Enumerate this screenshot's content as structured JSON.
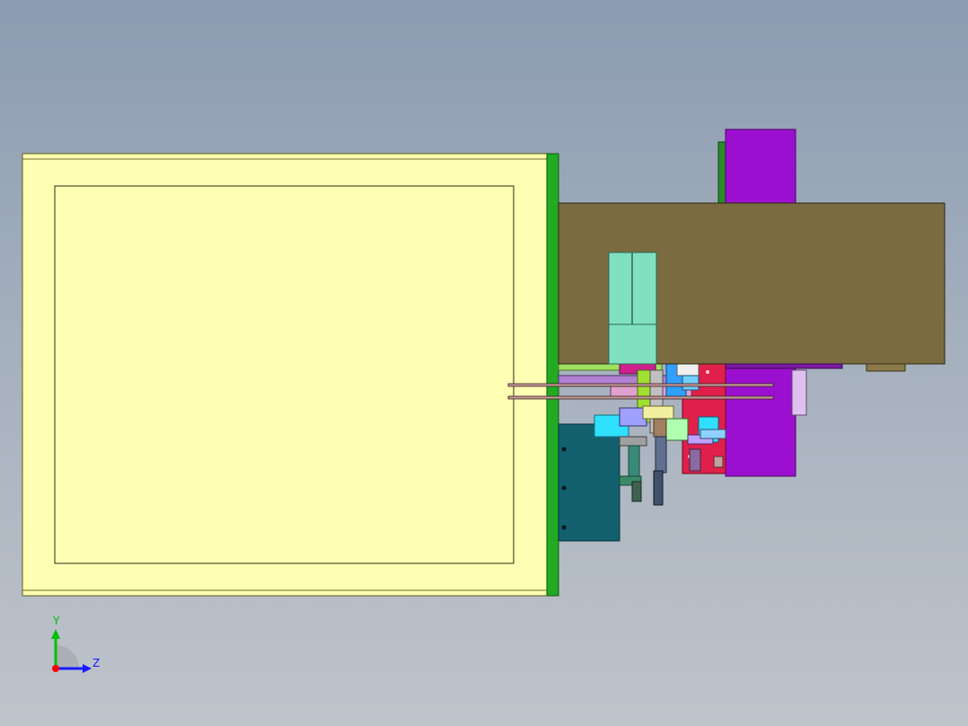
{
  "viewport": {
    "model": {
      "colors": {
        "hopper": "#ffffb3",
        "hopper_frame": "#5a5a1e",
        "flange": "#22aa22",
        "housing": "#7a6b41",
        "motor_block": "#9b10d0",
        "cylinder": "#80e0c0",
        "control_box": "#13606f",
        "bracket": "#e0204a"
      }
    },
    "triad": {
      "y_label": "Y",
      "z_label": "Z",
      "colors": {
        "y": "#00c000",
        "z": "#1a1aff",
        "x": "#ff0000"
      }
    }
  }
}
